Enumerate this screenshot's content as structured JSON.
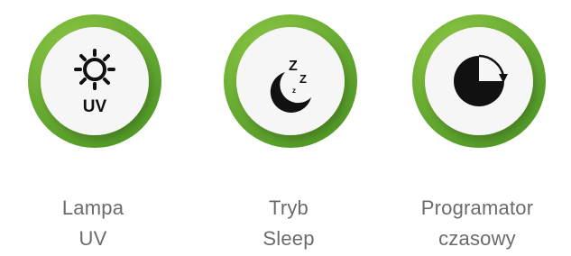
{
  "colors": {
    "ring_outer": "#5aa82f",
    "ring_inner": "#8cc63f",
    "disc": "#f6f6f6",
    "icon": "#111111",
    "caption_text": "#6b6b6b"
  },
  "features": [
    {
      "icon": "sun-uv-icon",
      "icon_text": "UV",
      "caption_line1": "Lampa",
      "caption_line2": "UV"
    },
    {
      "icon": "moon-sleep-icon",
      "icon_text": "",
      "caption_line1": "Tryb",
      "caption_line2": "Sleep"
    },
    {
      "icon": "timer-clock-icon",
      "icon_text": "",
      "caption_line1": "Programator",
      "caption_line2": "czasowy"
    }
  ]
}
